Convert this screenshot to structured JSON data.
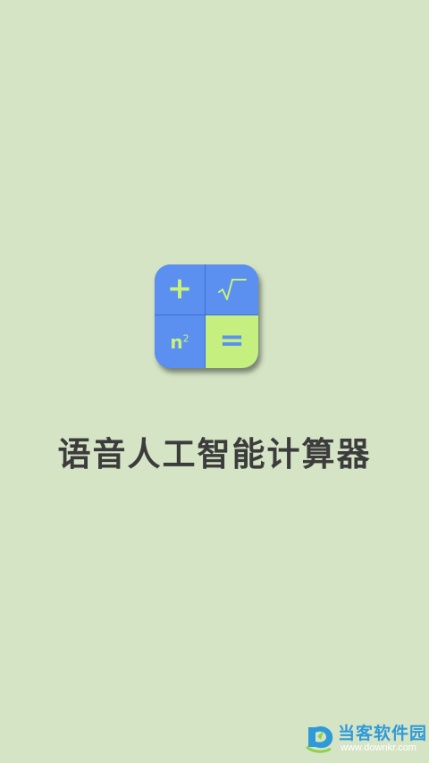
{
  "app": {
    "title": "语音人工智能计算器",
    "icon": {
      "name": "calculator-icon",
      "keys": {
        "top_left": "+",
        "top_right": "√‾",
        "bottom_left_base": "n",
        "bottom_left_exp": "2",
        "bottom_right": "="
      },
      "colors": {
        "blue": "#5b8ff0",
        "green": "#c5f07f",
        "border": "#3e6fd0"
      }
    }
  },
  "background_color": "#d6e4c6",
  "watermark": {
    "name": "当客软件园",
    "url": "www.downkr.com"
  }
}
